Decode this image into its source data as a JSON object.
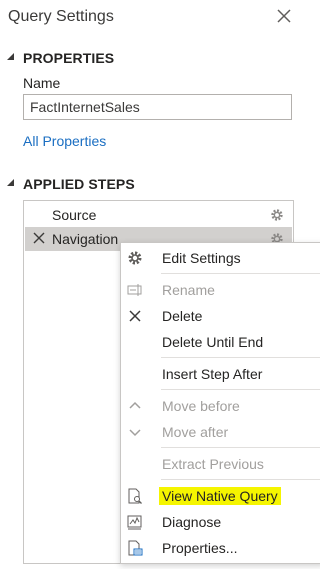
{
  "panel": {
    "title": "Query Settings",
    "close_icon": "close-icon"
  },
  "properties": {
    "header": "PROPERTIES",
    "name_label": "Name",
    "name_value": "FactInternetSales",
    "all_properties_link": "All Properties"
  },
  "applied_steps": {
    "header": "APPLIED STEPS",
    "steps": [
      {
        "label": "Source",
        "selected": false
      },
      {
        "label": "Navigation",
        "selected": true
      }
    ]
  },
  "context_menu": {
    "items": [
      {
        "label": "Edit Settings",
        "icon": "gear-icon",
        "enabled": true
      },
      {
        "label": "Rename",
        "icon": "rename-icon",
        "enabled": false
      },
      {
        "label": "Delete",
        "icon": "close-icon",
        "enabled": true
      },
      {
        "label": "Delete Until End",
        "enabled": true
      },
      {
        "label": "Insert Step After",
        "enabled": true
      },
      {
        "label": "Move before",
        "icon": "chevron-up-icon",
        "enabled": false
      },
      {
        "label": "Move after",
        "icon": "chevron-down-icon",
        "enabled": false
      },
      {
        "label": "Extract Previous",
        "enabled": false
      },
      {
        "label": "View Native Query",
        "icon": "native-query-icon",
        "enabled": true,
        "highlighted": true
      },
      {
        "label": "Diagnose",
        "icon": "diagnose-icon",
        "enabled": true
      },
      {
        "label": "Properties...",
        "icon": "properties-icon",
        "enabled": true
      }
    ]
  },
  "colors": {
    "accent_link": "#1a6ec2",
    "highlight": "#f5f500",
    "selected_row": "#d2d0ce"
  }
}
